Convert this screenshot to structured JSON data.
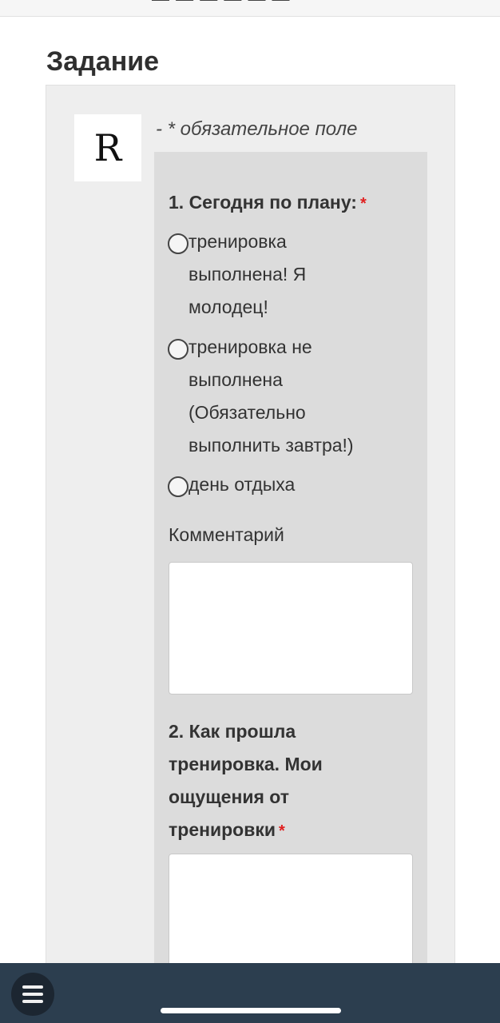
{
  "page_title": "Задание",
  "logo_letter": "R",
  "required_note": "- * обязательное поле",
  "question1": {
    "label": "1. Сегодня по плану:",
    "required_mark": "*",
    "options": [
      "тренировка выполнена! Я молодец!",
      "тренировка не выполнена (Обязательно выполнить завтра!)",
      "день отдыха"
    ],
    "comment_label": "Комментарий",
    "comment_value": ""
  },
  "question2": {
    "label": "2. Как прошла тренировка. Мои ощущения от тренировки",
    "required_mark": "*",
    "answer_value": ""
  },
  "colors": {
    "required_star": "#e02020",
    "bottom_bar": "#2c3e4f",
    "panel": "#eeeeee",
    "form_panel": "#dcdcdc"
  },
  "icons": {
    "menu": "hamburger-menu-icon"
  }
}
